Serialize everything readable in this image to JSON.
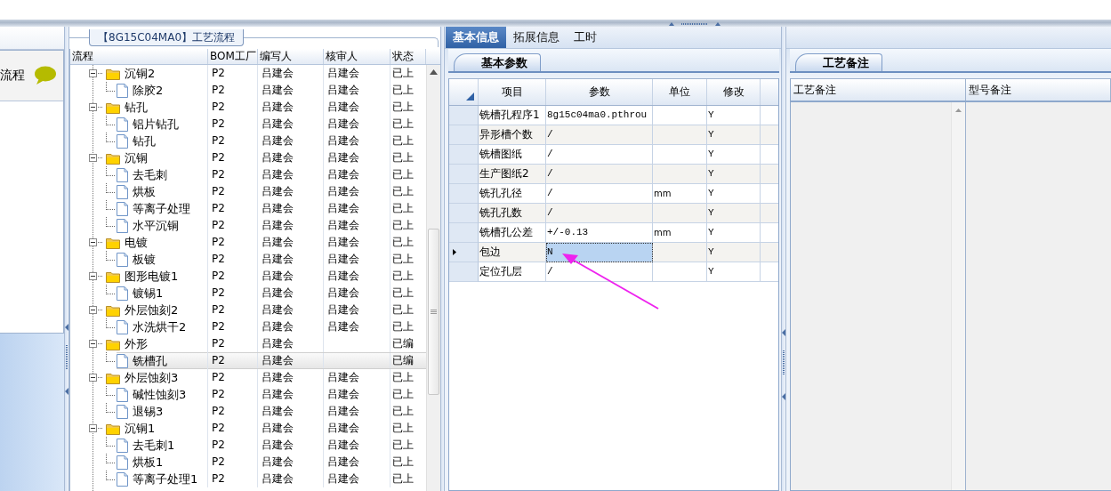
{
  "nav_panel": {
    "items": [
      {
        "label": "流程"
      }
    ]
  },
  "process_panel": {
    "title": "【8G15C04MA0】工艺流程",
    "columns": [
      "流程",
      "BOM工厂",
      "编写人",
      "核审人",
      "状态"
    ],
    "rows": [
      {
        "name": "沉铜2",
        "kind": "folder",
        "expanded": true,
        "selected": false,
        "bom": "P2",
        "author": "吕建会",
        "reviewer": "吕建会",
        "status": "已上",
        "children": [
          {
            "name": "除胶2",
            "kind": "step",
            "selected": false,
            "bom": "P2",
            "author": "吕建会",
            "reviewer": "吕建会",
            "status": "已上"
          }
        ]
      },
      {
        "name": "钻孔",
        "kind": "folder",
        "expanded": true,
        "selected": false,
        "bom": "P2",
        "author": "吕建会",
        "reviewer": "吕建会",
        "status": "已上",
        "children": [
          {
            "name": "铝片钻孔",
            "kind": "step",
            "selected": false,
            "bom": "P2",
            "author": "吕建会",
            "reviewer": "吕建会",
            "status": "已上"
          },
          {
            "name": "钻孔",
            "kind": "step",
            "selected": false,
            "bom": "P2",
            "author": "吕建会",
            "reviewer": "吕建会",
            "status": "已上"
          }
        ]
      },
      {
        "name": "沉铜",
        "kind": "folder",
        "expanded": true,
        "selected": false,
        "bom": "P2",
        "author": "吕建会",
        "reviewer": "吕建会",
        "status": "已上",
        "children": [
          {
            "name": "去毛刺",
            "kind": "step",
            "selected": false,
            "bom": "P2",
            "author": "吕建会",
            "reviewer": "吕建会",
            "status": "已上"
          },
          {
            "name": "烘板",
            "kind": "step",
            "selected": false,
            "bom": "P2",
            "author": "吕建会",
            "reviewer": "吕建会",
            "status": "已上"
          },
          {
            "name": "等离子处理",
            "kind": "step",
            "selected": false,
            "bom": "P2",
            "author": "吕建会",
            "reviewer": "吕建会",
            "status": "已上"
          },
          {
            "name": "水平沉铜",
            "kind": "step",
            "selected": false,
            "bom": "P2",
            "author": "吕建会",
            "reviewer": "吕建会",
            "status": "已上"
          }
        ]
      },
      {
        "name": "电镀",
        "kind": "folder",
        "expanded": true,
        "selected": false,
        "bom": "P2",
        "author": "吕建会",
        "reviewer": "吕建会",
        "status": "已上",
        "children": [
          {
            "name": "板镀",
            "kind": "step",
            "selected": false,
            "bom": "P2",
            "author": "吕建会",
            "reviewer": "吕建会",
            "status": "已上"
          }
        ]
      },
      {
        "name": "图形电镀1",
        "kind": "folder",
        "expanded": true,
        "selected": false,
        "bom": "P2",
        "author": "吕建会",
        "reviewer": "吕建会",
        "status": "已上",
        "children": [
          {
            "name": "镀锡1",
            "kind": "step",
            "selected": false,
            "bom": "P2",
            "author": "吕建会",
            "reviewer": "吕建会",
            "status": "已上"
          }
        ]
      },
      {
        "name": "外层蚀刻2",
        "kind": "folder",
        "expanded": true,
        "selected": false,
        "bom": "P2",
        "author": "吕建会",
        "reviewer": "吕建会",
        "status": "已上",
        "children": [
          {
            "name": "水洗烘干2",
            "kind": "step",
            "selected": false,
            "bom": "P2",
            "author": "吕建会",
            "reviewer": "吕建会",
            "status": "已上"
          }
        ]
      },
      {
        "name": "外形",
        "kind": "folder",
        "expanded": true,
        "selected": false,
        "bom": "P2",
        "author": "吕建会",
        "status": "已编",
        "children": [
          {
            "name": "铣槽孔",
            "kind": "step",
            "selected": true,
            "bom": "P2",
            "author": "吕建会",
            "status": "已编"
          }
        ]
      },
      {
        "name": "外层蚀刻3",
        "kind": "folder",
        "expanded": true,
        "selected": false,
        "bom": "P2",
        "author": "吕建会",
        "reviewer": "吕建会",
        "status": "已上",
        "children": [
          {
            "name": "碱性蚀刻3",
            "kind": "step",
            "selected": false,
            "bom": "P2",
            "author": "吕建会",
            "reviewer": "吕建会",
            "status": "已上"
          },
          {
            "name": "退锡3",
            "kind": "step",
            "selected": false,
            "bom": "P2",
            "author": "吕建会",
            "reviewer": "吕建会",
            "status": "已上"
          }
        ]
      },
      {
        "name": "沉铜1",
        "kind": "folder",
        "expanded": true,
        "selected": false,
        "bom": "P2",
        "author": "吕建会",
        "reviewer": "吕建会",
        "status": "已上",
        "children": [
          {
            "name": "去毛刺1",
            "kind": "step",
            "selected": false,
            "bom": "P2",
            "author": "吕建会",
            "reviewer": "吕建会",
            "status": "已上"
          },
          {
            "name": "烘板1",
            "kind": "step",
            "selected": false,
            "bom": "P2",
            "author": "吕建会",
            "reviewer": "吕建会",
            "status": "已上"
          },
          {
            "name": "等离子处理1",
            "kind": "step",
            "selected": false,
            "bom": "P2",
            "author": "吕建会",
            "reviewer": "吕建会",
            "status": "已上"
          }
        ]
      }
    ]
  },
  "detail_tabs": [
    {
      "label": "基本信息",
      "selected": true
    },
    {
      "label": "拓展信息",
      "selected": false
    },
    {
      "label": "工时",
      "selected": false
    }
  ],
  "param_tabs": [
    {
      "label": "基本参数",
      "selected": true
    }
  ],
  "param_grid": {
    "columns": [
      "项目",
      "参数",
      "单位",
      "修改"
    ],
    "rows": [
      {
        "item": "铣槽孔程序1",
        "value": "8g15c04ma0.pthrou",
        "modify": "Y",
        "current": false
      },
      {
        "item": "异形槽个数",
        "value": "/",
        "modify": "Y",
        "current": false
      },
      {
        "item": "铣槽图纸",
        "value": "/",
        "modify": "Y",
        "current": false
      },
      {
        "item": "生产图纸2",
        "value": "/",
        "modify": "Y",
        "current": false
      },
      {
        "item": "铣孔孔径",
        "value": "/",
        "unit": "mm",
        "modify": "Y",
        "current": false
      },
      {
        "item": "铣孔孔数",
        "value": "/",
        "modify": "Y",
        "current": false
      },
      {
        "item": "铣槽孔公差",
        "value": "+/-0.13",
        "unit": "mm",
        "modify": "Y",
        "current": false
      },
      {
        "item": "包边",
        "value": "N",
        "modify": "Y",
        "current": true
      },
      {
        "item": "定位孔层",
        "value": "/",
        "modify": "Y",
        "current": false
      }
    ]
  },
  "remark_tabs": [
    {
      "label": "工艺备注",
      "selected": true
    }
  ],
  "remark_grid": {
    "columns": [
      "工艺备注",
      "型号备注"
    ]
  }
}
